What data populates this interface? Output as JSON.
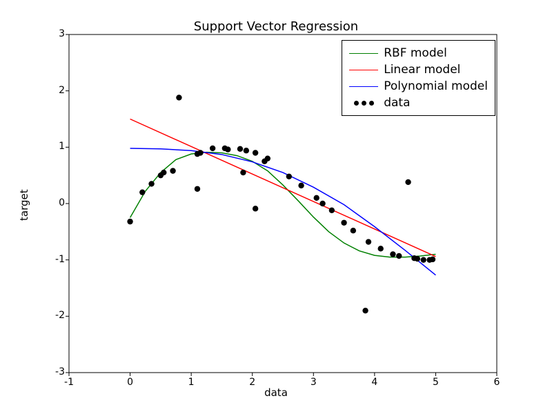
{
  "chart_data": {
    "type": "scatter",
    "title": "Support Vector Regression",
    "xlabel": "data",
    "ylabel": "target",
    "xlim": [
      -1,
      6
    ],
    "ylim": [
      -3,
      3
    ],
    "xticks": [
      -1,
      0,
      1,
      2,
      3,
      4,
      5,
      6
    ],
    "yticks": [
      -3,
      -2,
      -1,
      0,
      1,
      2,
      3
    ],
    "grid": false,
    "legend_position": "upper right",
    "series": [
      {
        "name": "RBF model",
        "kind": "line",
        "color": "#008000",
        "x": [
          0.0,
          0.25,
          0.5,
          0.75,
          1.0,
          1.25,
          1.5,
          1.75,
          2.0,
          2.25,
          2.5,
          2.75,
          3.0,
          3.25,
          3.5,
          3.75,
          4.0,
          4.25,
          4.5,
          4.75,
          5.0
        ],
        "y": [
          -0.25,
          0.22,
          0.55,
          0.78,
          0.88,
          0.91,
          0.9,
          0.85,
          0.75,
          0.58,
          0.33,
          0.05,
          -0.24,
          -0.5,
          -0.7,
          -0.84,
          -0.92,
          -0.95,
          -0.95,
          -0.93,
          -0.9
        ]
      },
      {
        "name": "Linear model",
        "kind": "line",
        "color": "#ff0000",
        "x": [
          0.0,
          5.0
        ],
        "y": [
          1.5,
          -0.94
        ]
      },
      {
        "name": "Polynomial model",
        "kind": "line",
        "color": "#0000ff",
        "x": [
          0.0,
          0.5,
          1.0,
          1.5,
          2.0,
          2.5,
          3.0,
          3.5,
          4.0,
          4.5,
          5.0
        ],
        "y": [
          0.98,
          0.97,
          0.94,
          0.87,
          0.74,
          0.55,
          0.29,
          -0.02,
          -0.41,
          -0.83,
          -1.27
        ]
      },
      {
        "name": "data",
        "kind": "scatter",
        "color": "#000000",
        "x": [
          0.0,
          0.2,
          0.35,
          0.5,
          0.55,
          0.7,
          0.8,
          1.1,
          1.1,
          1.15,
          1.35,
          1.55,
          1.6,
          1.8,
          1.85,
          1.9,
          2.05,
          2.05,
          2.2,
          2.25,
          2.6,
          2.8,
          3.05,
          3.15,
          3.3,
          3.5,
          3.65,
          3.85,
          3.9,
          4.1,
          4.3,
          4.4,
          4.55,
          4.65,
          4.7,
          4.8,
          4.9,
          4.95
        ],
        "y": [
          -0.32,
          0.2,
          0.35,
          0.5,
          0.55,
          0.58,
          1.88,
          0.88,
          0.26,
          0.9,
          0.98,
          0.98,
          0.96,
          0.97,
          0.55,
          0.94,
          0.9,
          -0.09,
          0.75,
          0.8,
          0.48,
          0.32,
          0.1,
          0.0,
          -0.12,
          -0.34,
          -0.48,
          -1.9,
          -0.68,
          -0.8,
          -0.9,
          -0.93,
          0.38,
          -0.97,
          -0.98,
          -1.0,
          -1.0,
          -0.99
        ]
      }
    ]
  }
}
